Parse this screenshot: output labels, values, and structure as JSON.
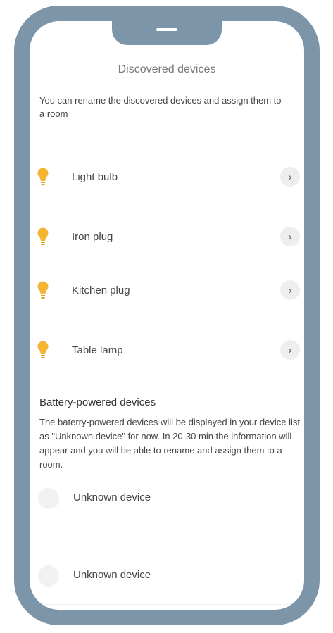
{
  "header": {
    "title": "Discovered devices"
  },
  "intro": "You can rename the discovered devices and assign them to a room",
  "devices": [
    {
      "label": "Light bulb",
      "icon": "light-bulb-icon"
    },
    {
      "label": "Iron plug",
      "icon": "light-bulb-icon"
    },
    {
      "label": "Kitchen plug",
      "icon": "light-bulb-icon"
    },
    {
      "label": "Table lamp",
      "icon": "light-bulb-icon"
    }
  ],
  "battery": {
    "title": "Battery-powered devices",
    "description": "The baterry-powered devices will be displayed in your device list as \"Unknown device\" for now. In 20-30 min the information will appear and you will be able to rename and assign them to a room.",
    "devices": [
      {
        "label": "Unknown device"
      },
      {
        "label": "Unknown device"
      }
    ]
  },
  "colors": {
    "frame": "#7d95a8",
    "bulb": "#f4b533"
  }
}
